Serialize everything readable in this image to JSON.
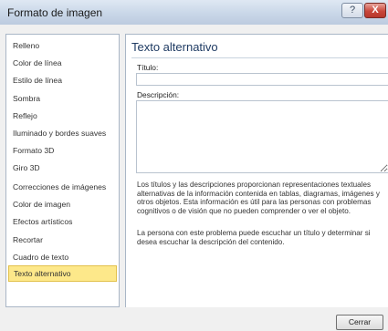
{
  "window": {
    "title": "Formato de imagen",
    "help_glyph": "?",
    "close_glyph": "X"
  },
  "sidebar": {
    "items": [
      {
        "label": "Relleno"
      },
      {
        "label": "Color de línea"
      },
      {
        "label": "Estilo de línea"
      },
      {
        "label": "Sombra"
      },
      {
        "label": "Reflejo"
      },
      {
        "label": "Iluminado y bordes suaves"
      },
      {
        "label": "Formato 3D"
      },
      {
        "label": "Giro 3D"
      },
      {
        "label": "Correcciones de imágenes"
      },
      {
        "label": "Color de imagen"
      },
      {
        "label": "Efectos artísticos"
      },
      {
        "label": "Recortar"
      },
      {
        "label": "Cuadro de texto"
      },
      {
        "label": "Texto alternativo",
        "selected": true
      }
    ]
  },
  "panel": {
    "heading": "Texto alternativo",
    "title_label": "Título:",
    "title_value": "",
    "description_label": "Descripción:",
    "description_value": "",
    "help_paragraph_1": "Los títulos y las descripciones proporcionan representaciones textuales alternativas de la información contenida en tablas, diagramas, imágenes y otros objetos. Esta información es útil para las personas con problemas cognitivos o de visión que no pueden comprender o ver el objeto.",
    "help_paragraph_2": "La persona con este problema puede escuchar un título y determinar si desea escuchar la descripción del contenido."
  },
  "footer": {
    "close_label": "Cerrar"
  },
  "colors": {
    "selection_highlight": "#fde88a",
    "heading_text": "#1f3b63",
    "title_close_button": "#c9463a"
  }
}
